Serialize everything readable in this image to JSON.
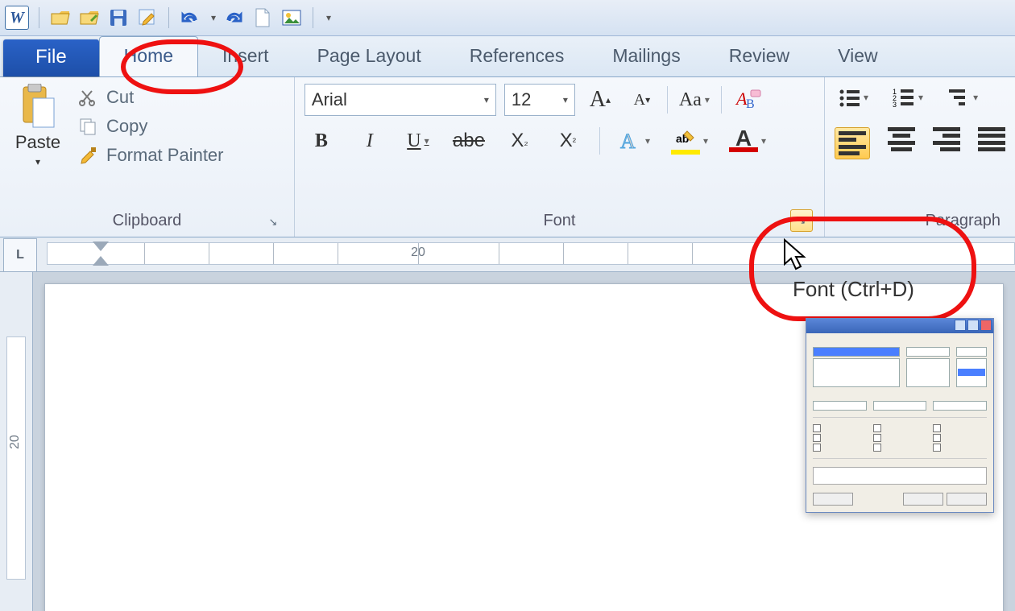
{
  "qat": {
    "app_letter": "W"
  },
  "tabs": {
    "file": "File",
    "home": "Home",
    "insert": "Insert",
    "page_layout": "Page Layout",
    "references": "References",
    "mailings": "Mailings",
    "review": "Review",
    "view": "View"
  },
  "clipboard": {
    "paste": "Paste",
    "cut": "Cut",
    "copy": "Copy",
    "format_painter": "Format Painter",
    "group_label": "Clipboard"
  },
  "font": {
    "name": "Arial",
    "size": "12",
    "group_label": "Font",
    "tooltip": "Font (Ctrl+D)"
  },
  "paragraph": {
    "group_label": "Paragraph"
  },
  "ruler": {
    "h_tick": "20",
    "v_tick": "20"
  }
}
